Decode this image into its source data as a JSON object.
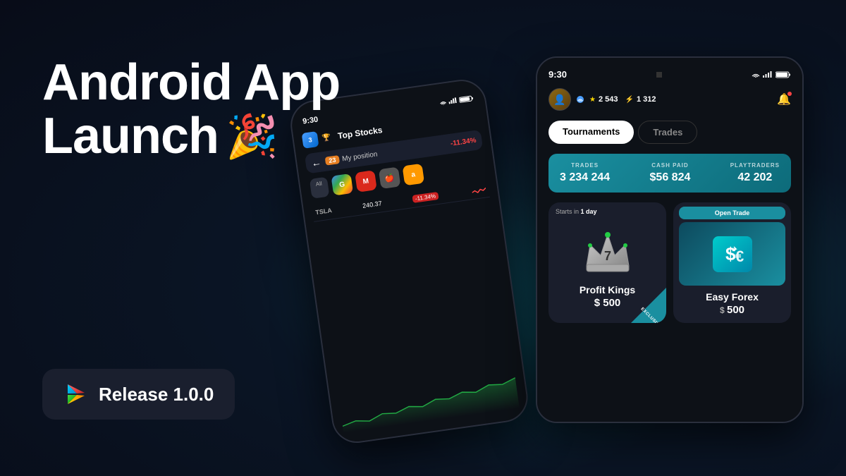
{
  "page": {
    "background_color": "#0a0e1a"
  },
  "headline": {
    "line1": "Android App",
    "line2": "Launch",
    "emoji": "🎉"
  },
  "release_badge": {
    "label": "Release 1.0.0"
  },
  "phone_left": {
    "time": "9:30",
    "header": "Top Stocks",
    "position_number": "23",
    "position_label": "My position",
    "position_change": "-11.34%",
    "ticker": "TSLA",
    "price": "240.37",
    "change": "-11.34%"
  },
  "phone_right": {
    "time": "9:30",
    "stars": "2 543",
    "shields": "1 312",
    "tabs": {
      "active": "Tournaments",
      "inactive": "Trades"
    },
    "stats": {
      "trades_label": "TRADES",
      "trades_value": "3 234 244",
      "cash_label": "CASH PAID",
      "cash_value": "$56 824",
      "players_label": "PLAYTRADERS",
      "players_value": "42 202"
    },
    "tournament1": {
      "starts_in": "Starts in",
      "starts_value": "1 day",
      "name": "Profit Kings",
      "price": "$ 500",
      "badge": "EXCLUSIVE"
    },
    "tournament2": {
      "open_trade": "Open Trade",
      "name": "Easy Forex",
      "price": "$ 500"
    }
  }
}
